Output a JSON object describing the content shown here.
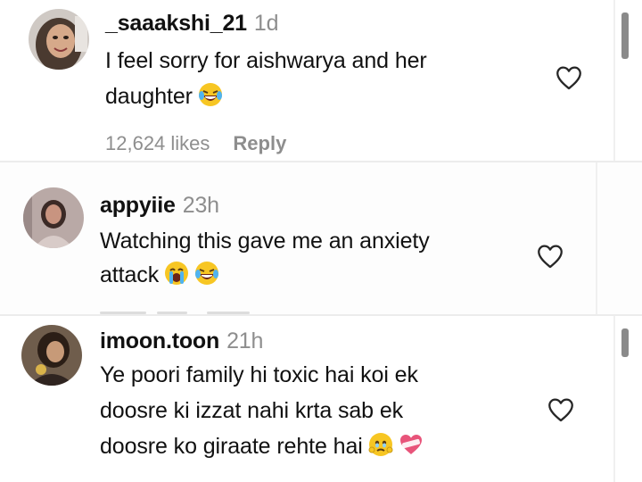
{
  "comments": [
    {
      "username": "_saaakshi_21",
      "time": "1d",
      "lines": [
        "I feel sorry for aishwarya and her",
        "daughter"
      ],
      "emojis": [
        "laughing-tears-emoji"
      ],
      "likes": "12,624 likes",
      "reply": "Reply"
    },
    {
      "username": "appyiie",
      "time": "23h",
      "lines": [
        "Watching this gave me an anxiety",
        "attack"
      ],
      "emojis": [
        "loudly-crying-emoji",
        "laughing-tears-emoji"
      ]
    },
    {
      "username": "imoon.toon",
      "time": "21h",
      "lines": [
        "Ye poori family hi toxic hai koi ek",
        "doosre ki izzat nahi krta sab ek",
        "doosre ko giraate rehte hai"
      ],
      "emojis": [
        "face-holding-back-tears-emoji",
        "mending-heart-emoji"
      ]
    }
  ],
  "icons": {
    "like": "heart-outline-icon"
  },
  "colors": {
    "text": "#111111",
    "muted": "#8e8e8e",
    "heart_stroke": "#262626"
  }
}
